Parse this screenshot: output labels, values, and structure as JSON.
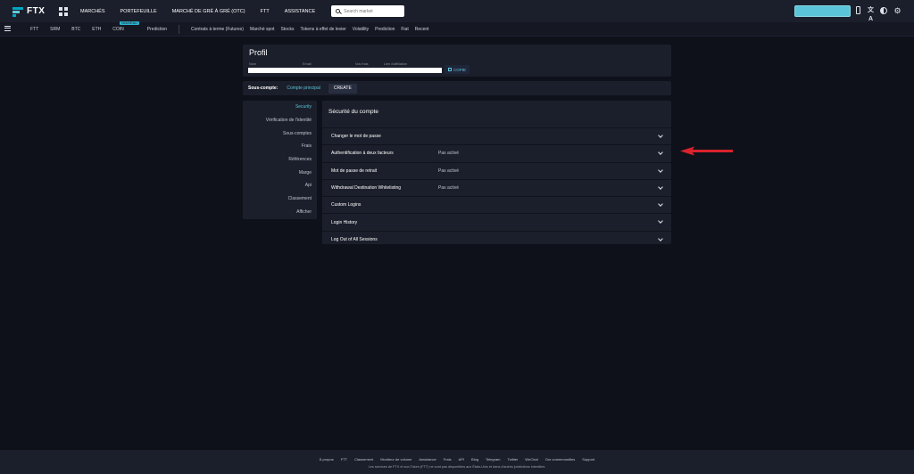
{
  "topbar": {
    "logo_text": "FTX",
    "nav": [
      "MARCHÉS",
      "PORTEFEUILLE",
      "MARCHÉ DE GRÉ À GRÉ (OTC)",
      "FTT",
      "ASSISTANCE"
    ],
    "search_placeholder": "Search market"
  },
  "subbar": {
    "markets": [
      "FTT",
      "SRM",
      "BTC",
      "ETH",
      "COIN",
      "Prediction"
    ],
    "new_badge": "NOUVEAU",
    "categories": [
      "Contrats à terme (Futures)",
      "Marché spot",
      "Stocks",
      "Tokens à effet de levier",
      "Volatility",
      "Prediction",
      "Fiat",
      "Recent"
    ]
  },
  "profile": {
    "title": "Profil",
    "field_labels": [
      "Nom",
      "Email",
      "Vos frais",
      "Lien d'affiliation"
    ],
    "copy_label": "COPIE"
  },
  "subaccount": {
    "label": "Sous-compte:",
    "main": "Compte principal",
    "create": "CREATE"
  },
  "leftmenu": {
    "items": [
      "Security",
      "Vérification de l'identité",
      "Sous-comptes",
      "Frais",
      "Références",
      "Marge",
      "Api",
      "Classement",
      "Afficher"
    ]
  },
  "security": {
    "title": "Sécurité du compte",
    "rows": [
      {
        "label": "Changer le mot de passe",
        "status": ""
      },
      {
        "label": "Authentification à deux facteurs",
        "status": "Pas activé"
      },
      {
        "label": "Mot de passe de retrait",
        "status": "Pas activé"
      },
      {
        "label": "Withdrawal Destination Whitelisting",
        "status": "Pas activé"
      },
      {
        "label": "Custom Logins",
        "status": ""
      },
      {
        "label": "Login History",
        "status": ""
      },
      {
        "label": "Log Out of All Sessions",
        "status": ""
      }
    ]
  },
  "annotation": {
    "arrow_color": "#d9232d"
  },
  "footer": {
    "links": [
      "À propos",
      "FTT",
      "Classement",
      "Moniteur de volume",
      "Assistance",
      "Frais",
      "API",
      "Blog",
      "Telegram",
      "Twitter",
      "WeChat",
      "Our commmunities",
      "Support"
    ],
    "note": "Les services de FTX et son Token (FTT) ne sont pas disponibles aux États-Unis et dans d'autres juridictions interdites."
  },
  "colors": {
    "accent": "#5bc4d9",
    "background": "#0f111a",
    "panel": "#1b1f2b"
  }
}
